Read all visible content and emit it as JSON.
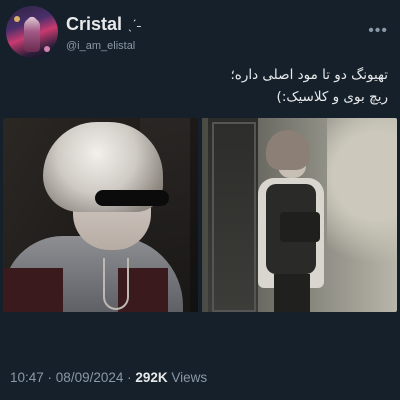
{
  "user": {
    "name": "Cristal",
    "sparkle": "ˎˊ˗",
    "handle": "@i_am_elistal"
  },
  "tweet": {
    "lines": [
      "تهیونگ دو تا مود اصلی داره؛",
      "ریچ بوی و کلاسیک:)"
    ]
  },
  "meta": {
    "time": "10:47",
    "separator1": " · ",
    "date": "08/09/2024",
    "separator2": " · ",
    "views_count": "292K",
    "views_label": " Views"
  },
  "icons": {
    "more": "more-icon"
  },
  "colors": {
    "background": "#15202b",
    "text": "#e7e9ea",
    "muted": "#8b98a5"
  }
}
